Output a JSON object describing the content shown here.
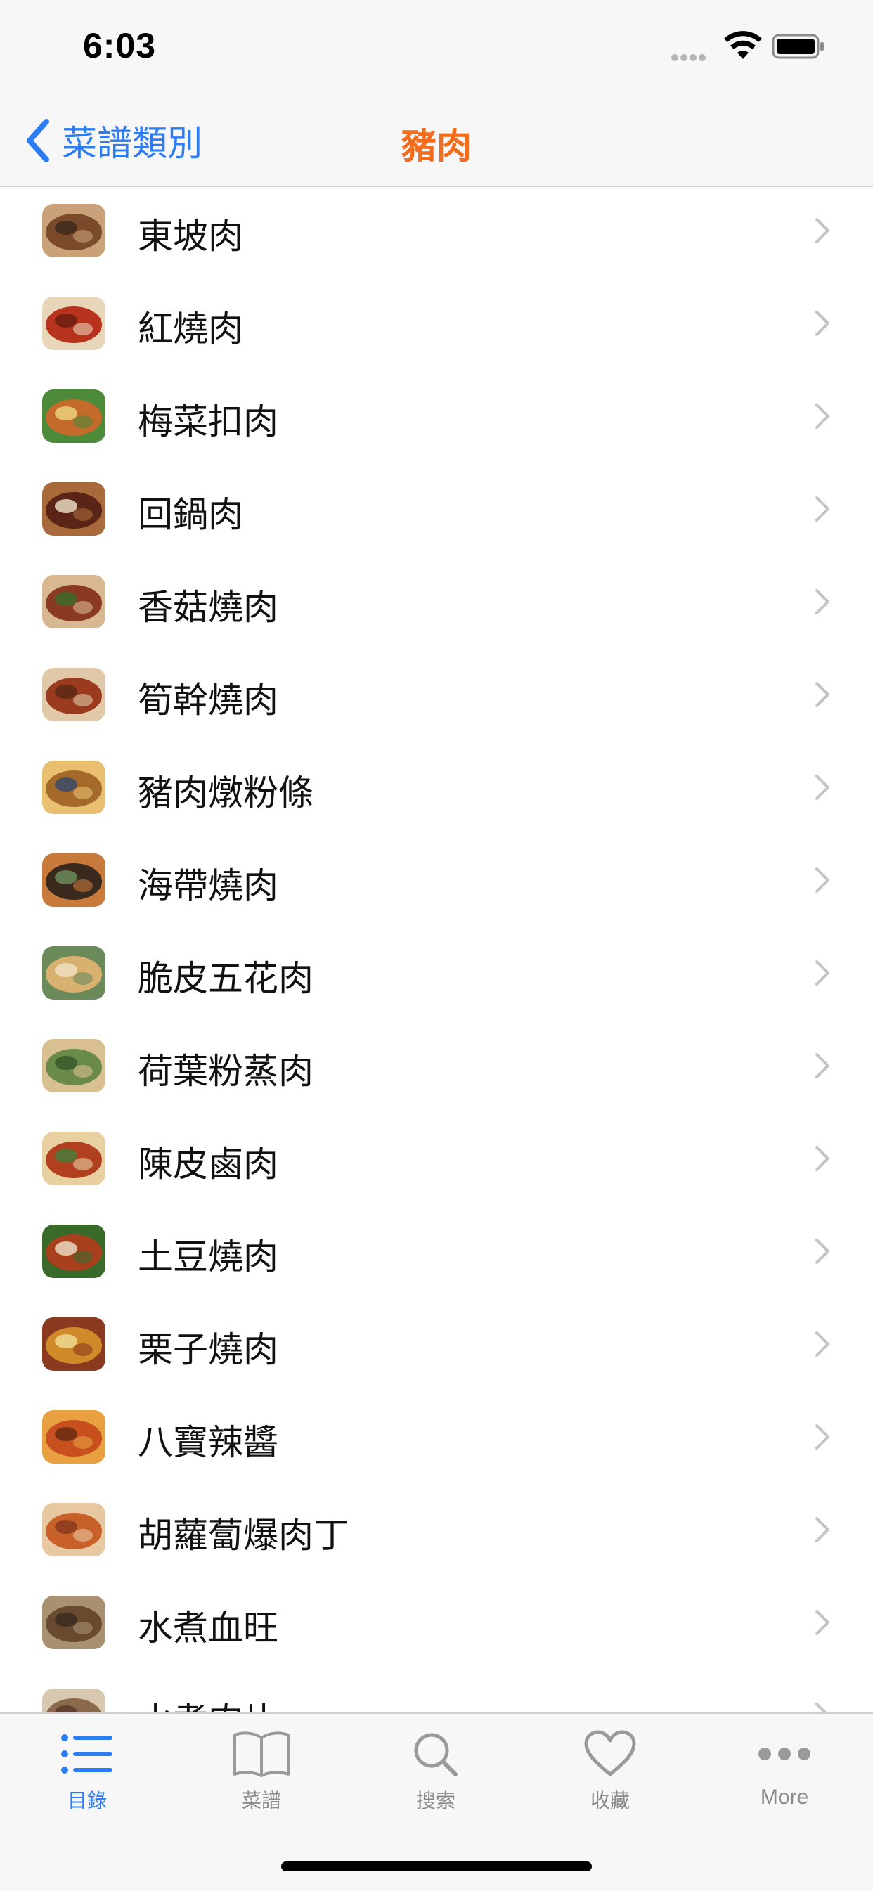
{
  "status_bar": {
    "time": "6:03"
  },
  "nav": {
    "back_label": "菜譜類別",
    "title": "豬肉",
    "accent_color": "#2b7cf5",
    "title_color": "#f26c1b"
  },
  "list": {
    "items": [
      {
        "label": "東坡肉",
        "colors": [
          "#7a4a2a",
          "#c9a27a",
          "#3d2a1a"
        ]
      },
      {
        "label": "紅燒肉",
        "colors": [
          "#b8331e",
          "#e7d6b8",
          "#6b2012"
        ]
      },
      {
        "label": "梅菜扣肉",
        "colors": [
          "#c46a2b",
          "#4d8a3a",
          "#e9d07a"
        ]
      },
      {
        "label": "回鍋肉",
        "colors": [
          "#5a2416",
          "#a86a3a",
          "#e8d9c0"
        ]
      },
      {
        "label": "香菇燒肉",
        "colors": [
          "#8a3a22",
          "#d8b890",
          "#3e6a2a"
        ]
      },
      {
        "label": "筍幹燒肉",
        "colors": [
          "#9a3a1e",
          "#e0c8a8",
          "#5a2a14"
        ]
      },
      {
        "label": "豬肉燉粉條",
        "colors": [
          "#a56a2a",
          "#e8c070",
          "#3a4a6a"
        ]
      },
      {
        "label": "海帶燒肉",
        "colors": [
          "#3a2a1e",
          "#c87a3a",
          "#6a8a5a"
        ]
      },
      {
        "label": "脆皮五花肉",
        "colors": [
          "#d8b070",
          "#6a8a5a",
          "#f0e0c0"
        ]
      },
      {
        "label": "荷葉粉蒸肉",
        "colors": [
          "#6a8a4a",
          "#d8c090",
          "#3a5a2a"
        ]
      },
      {
        "label": "陳皮鹵肉",
        "colors": [
          "#b0401e",
          "#e8d0a0",
          "#4a7a3a"
        ]
      },
      {
        "label": "土豆燒肉",
        "colors": [
          "#a8401e",
          "#3a6a2a",
          "#e8d8c0"
        ]
      },
      {
        "label": "栗子燒肉",
        "colors": [
          "#d08a2a",
          "#8a3a1e",
          "#f0d890"
        ]
      },
      {
        "label": "八寶辣醬",
        "colors": [
          "#c8501e",
          "#e8a040",
          "#6a2a12"
        ]
      },
      {
        "label": "胡蘿蔔爆肉丁",
        "colors": [
          "#c8602a",
          "#e8c8a0",
          "#8a3a1e"
        ]
      },
      {
        "label": "水煮血旺",
        "colors": [
          "#6a4a2e",
          "#a89070",
          "#3a2a1e"
        ]
      },
      {
        "label": "水煮肉片",
        "colors": [
          "#8a6a4a",
          "#d8c8b0",
          "#5a3a2a"
        ]
      }
    ]
  },
  "tabs": [
    {
      "label": "目錄",
      "icon": "list-icon",
      "active": true
    },
    {
      "label": "菜譜",
      "icon": "book-icon",
      "active": false
    },
    {
      "label": "搜索",
      "icon": "search-icon",
      "active": false
    },
    {
      "label": "收藏",
      "icon": "heart-icon",
      "active": false
    },
    {
      "label": "More",
      "icon": "more-icon",
      "active": false
    }
  ]
}
